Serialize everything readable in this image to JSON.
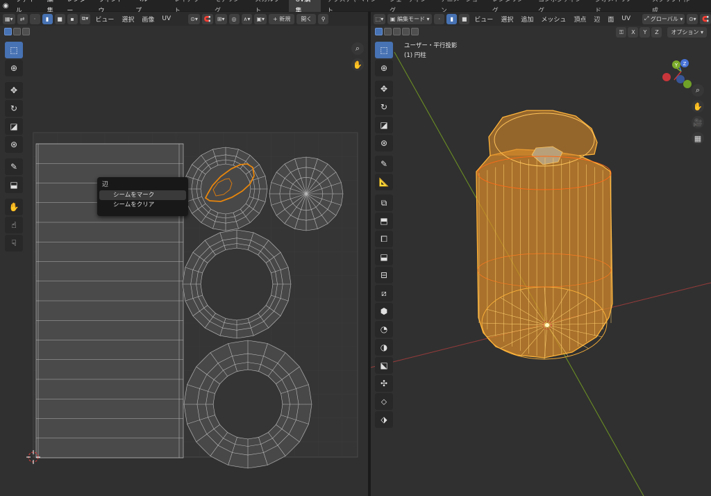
{
  "topbar": {
    "menus": [
      "ファイル",
      "編集",
      "レンダー",
      "ウィンドウ",
      "ヘルプ"
    ],
    "workspaces": [
      "レイアウト",
      "モデリング",
      "スカルプト",
      "UV編集",
      "テクスチャペイント",
      "シェーディング",
      "アニメーション",
      "レンダリング",
      "コンポジティング",
      "ジオメトリノード",
      "スクリプト作成"
    ],
    "active_workspace": "UV編集",
    "add_tab": "+"
  },
  "uv_editor": {
    "header": {
      "view": "ビュー",
      "select": "選択",
      "image": "画像",
      "uv": "UV",
      "new_label": "新規",
      "open_label": "開く"
    },
    "context_menu": {
      "title": "辺",
      "items": [
        "シームをマーク",
        "シームをクリア"
      ]
    }
  },
  "viewport": {
    "header": {
      "mode": "編集モード",
      "view": "ビュー",
      "select": "選択",
      "add": "追加",
      "mesh": "メッシュ",
      "vertex": "頂点",
      "edge": "辺",
      "face": "面",
      "uv": "UV",
      "orientation": "グローバル",
      "options": "オプション",
      "axes": [
        "X",
        "Y",
        "Z"
      ]
    },
    "info": {
      "projection": "ユーザー・平行投影",
      "object": "(1) 円柱"
    },
    "gizmo_axes": [
      "X",
      "Y",
      "Z"
    ]
  },
  "colors": {
    "accent": "#4772b3",
    "selection": "#ffa000",
    "seam": "#e8601c",
    "x_axis": "#9e3a3a",
    "y_axis": "#6a8e23"
  }
}
